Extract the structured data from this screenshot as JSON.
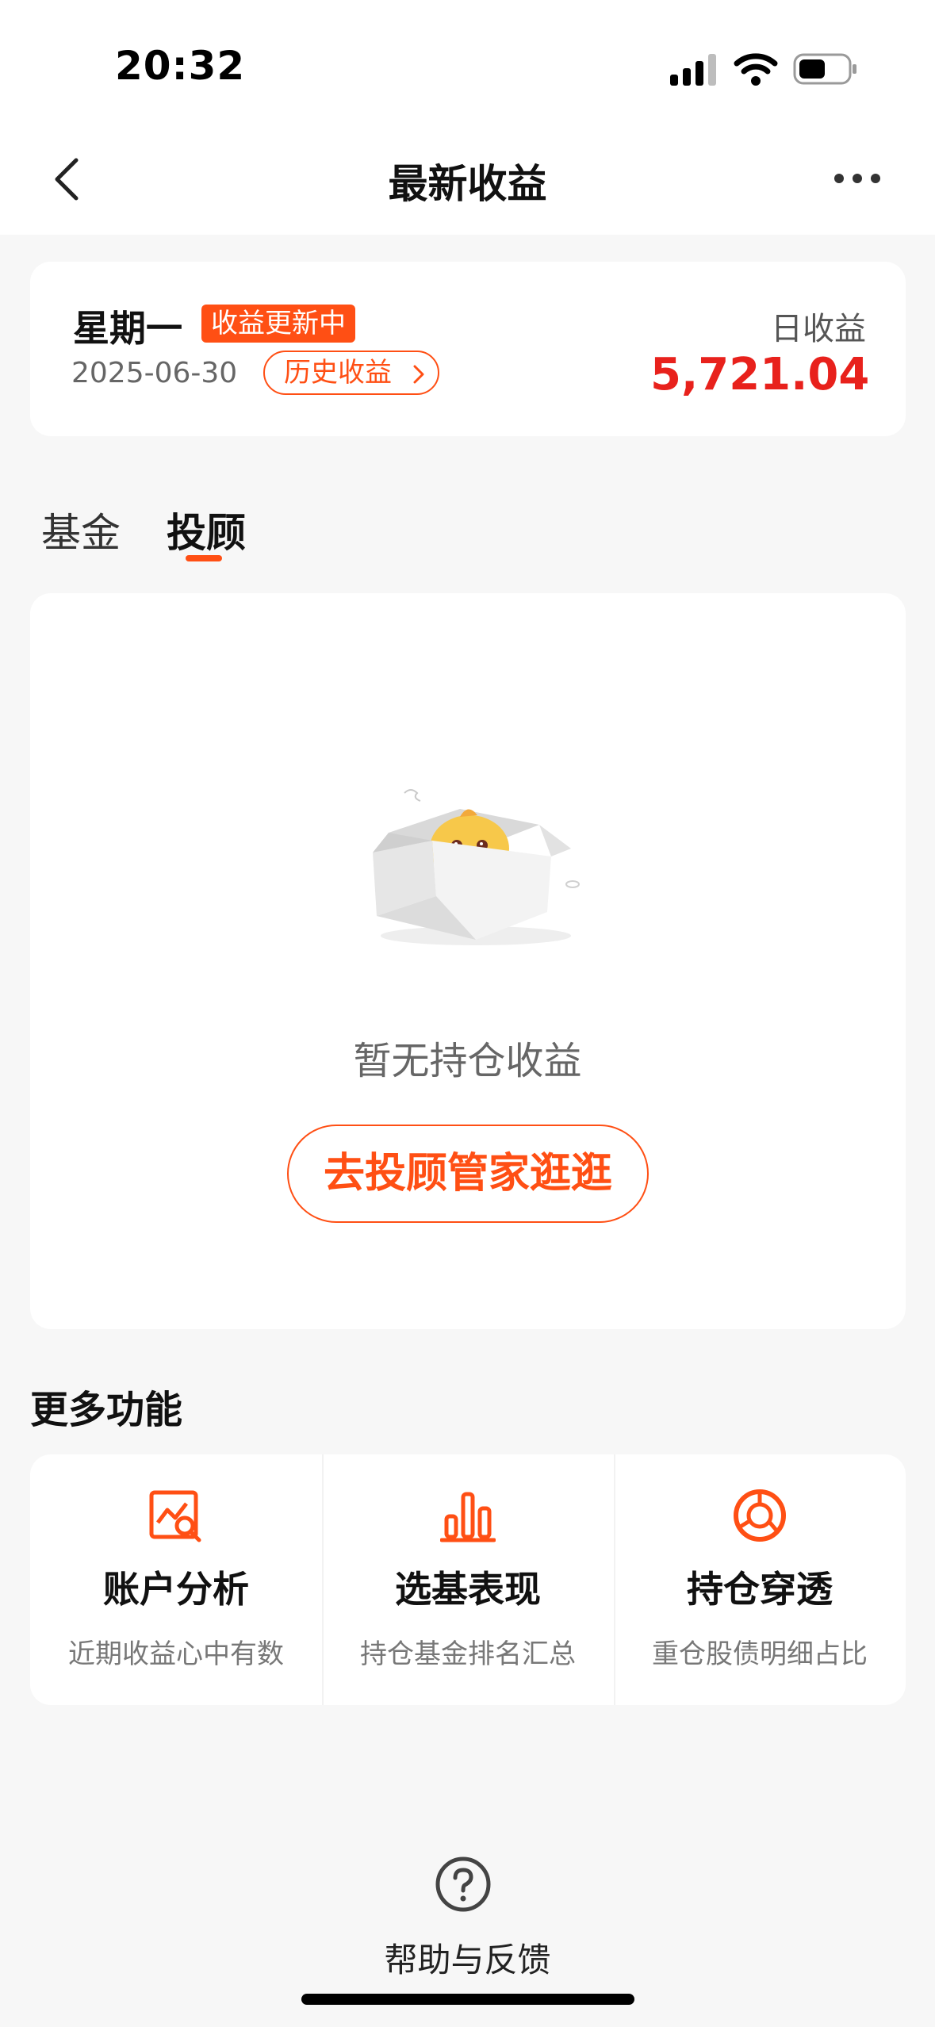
{
  "status_bar": {
    "time": "20:32"
  },
  "nav": {
    "title": "最新收益",
    "back_icon": "chevron-left-icon",
    "more_icon": "ellipsis-icon"
  },
  "summary": {
    "weekday": "星期一",
    "badge": "收益更新中",
    "date": "2025-06-30",
    "history_label": "历史收益",
    "daily_label": "日收益",
    "daily_value": "5,721.04"
  },
  "tabs": [
    {
      "label": "基金",
      "active": false
    },
    {
      "label": "投顾",
      "active": true
    }
  ],
  "empty_state": {
    "message": "暂无持仓收益",
    "button_label": "去投顾管家逛逛"
  },
  "more_features": {
    "title": "更多功能",
    "items": [
      {
        "title": "账户分析",
        "subtitle": "近期收益心中有数",
        "icon": "chart-search-icon"
      },
      {
        "title": "选基表现",
        "subtitle": "持仓基金排名汇总",
        "icon": "bar-chart-icon"
      },
      {
        "title": "持仓穿透",
        "subtitle": "重仓股债明细占比",
        "icon": "donut-chart-icon"
      }
    ]
  },
  "help": {
    "label": "帮助与反馈",
    "icon": "question-circle-icon"
  },
  "colors": {
    "accent": "#ff4f14",
    "value_red": "#e8211c",
    "background": "#f7f7f7"
  }
}
